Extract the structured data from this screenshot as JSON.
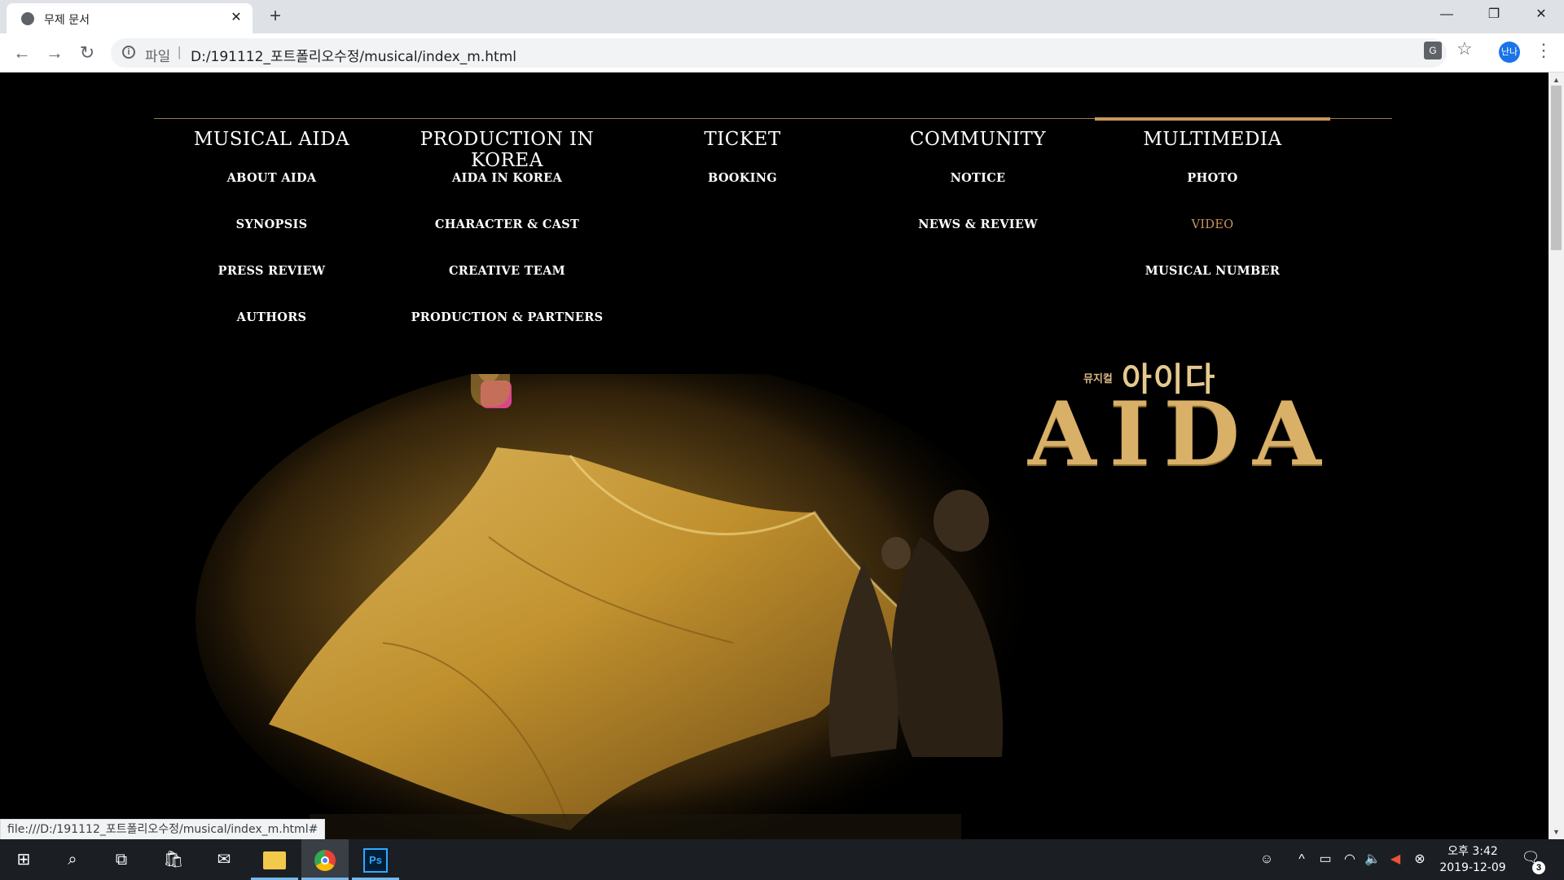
{
  "browser": {
    "tab_title": "무제 문서",
    "tab_close": "✕",
    "new_tab": "+",
    "window_controls": {
      "minimize": "—",
      "restore": "❐",
      "close": "✕"
    },
    "nav": {
      "back": "←",
      "forward": "→",
      "reload": "↻"
    },
    "address": {
      "info": "i",
      "scheme_label": "파일",
      "separator": "|",
      "url": "D:/191112_포트폴리오수정/musical/index_m.html"
    },
    "translate_icon": "G",
    "bookmark_star": "☆",
    "profile_initials": "난나",
    "menu": "⋮",
    "status_url": "file:///D:/191112_포트폴리오수정/musical/index_m.html#"
  },
  "gnb": {
    "accent_color": "#c9975a",
    "menus": [
      {
        "title": "MUSICAL AIDA",
        "items": [
          "ABOUT AIDA",
          "SYNOPSIS",
          "PRESS REVIEW",
          "AUTHORS"
        ]
      },
      {
        "title": "PRODUCTION IN KOREA",
        "items": [
          "AIDA IN KOREA",
          "CHARACTER & CAST",
          "CREATIVE TEAM",
          "PRODUCTION & PARTNERS"
        ]
      },
      {
        "title": "TICKET",
        "items": [
          "BOOKING"
        ]
      },
      {
        "title": "COMMUNITY",
        "items": [
          "NOTICE",
          "NEWS & REVIEW"
        ]
      },
      {
        "title": "MULTIMEDIA",
        "items": [
          "PHOTO",
          "VIDEO",
          "MUSICAL NUMBER"
        ],
        "active_item": "VIDEO"
      }
    ]
  },
  "hero": {
    "logo_small": "뮤지컬",
    "logo_korean": "아이다",
    "logo_title": "AIDA"
  },
  "taskbar": {
    "start": "⊞",
    "search": "⌕",
    "task_view": "⧉",
    "store": "🛍",
    "mail": "✉",
    "photoshop_label": "Ps",
    "tray_people": "☺",
    "tray_chevron": "^",
    "tray_battery": "▭",
    "tray_wifi": "◠",
    "tray_volume": "🔈",
    "tray_speaker_alert": "◀",
    "tray_x": "⊗",
    "clock_time": "오후 3:42",
    "clock_date": "2019-12-09",
    "notification_icon": "🗨",
    "notification_count": "3"
  }
}
